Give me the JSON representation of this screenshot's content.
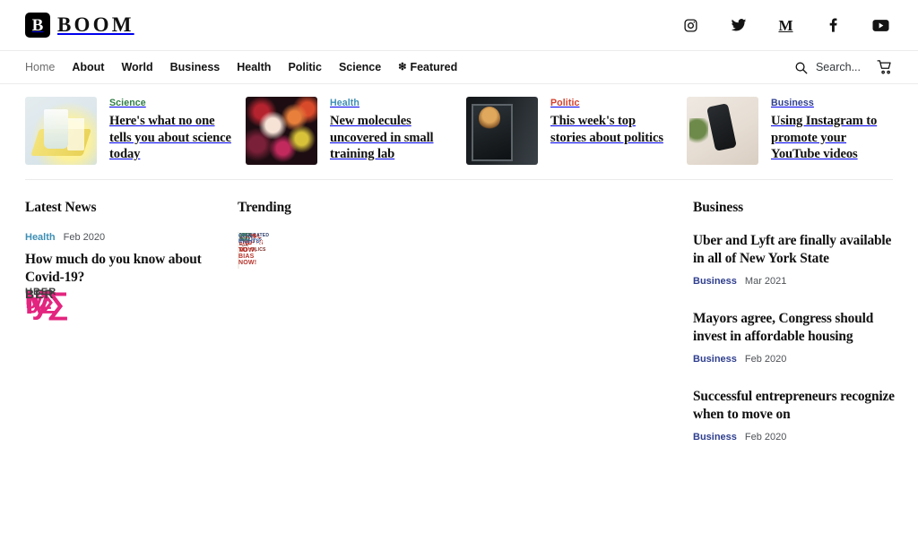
{
  "site": {
    "logo_mark": "B",
    "logo_text": "BOOM"
  },
  "social": [
    {
      "name": "instagram-icon",
      "label": "Instagram"
    },
    {
      "name": "twitter-icon",
      "label": "Twitter"
    },
    {
      "name": "medium-icon",
      "label": "M"
    },
    {
      "name": "facebook-icon",
      "label": "Facebook"
    },
    {
      "name": "youtube-icon",
      "label": "YouTube"
    }
  ],
  "nav": {
    "items": [
      {
        "label": "Home",
        "active": true
      },
      {
        "label": "About",
        "active": false
      },
      {
        "label": "World",
        "active": false
      },
      {
        "label": "Business",
        "active": false
      },
      {
        "label": "Health",
        "active": false
      },
      {
        "label": "Politic",
        "active": false
      },
      {
        "label": "Science",
        "active": false
      }
    ],
    "featured_label": "Featured",
    "featured_icon": "❇",
    "search_placeholder": "Search...",
    "cart_icon": "cart-icon"
  },
  "colors": {
    "science": "#2e7d46",
    "health": "#3d8fb5",
    "politic": "#d6402c",
    "business": "#2f3f8f",
    "text": "#111111",
    "muted": "#4e5257",
    "rule": "#eaeaea"
  },
  "featured": [
    {
      "category": "Science",
      "title": "Here's what no one tells you about science today",
      "thumb": "science-lab-flasks"
    },
    {
      "category": "Health",
      "title": "New molecules uncovered in small training lab",
      "thumb": "colorful-bokeh-molecules"
    },
    {
      "category": "Politic",
      "title": "This week's top stories about politics",
      "thumb": "politician-portrait-frame"
    },
    {
      "category": "Business",
      "title": "Using Instagram to promote your YouTube videos",
      "thumb": "hand-holding-phone-instagram"
    }
  ],
  "latest_news": {
    "heading": "Latest News",
    "articles": [
      {
        "thumb": "covid-19-vaccine-vials",
        "category": "Health",
        "date": "Feb 2020",
        "title": "How much do you know about Covid-19?"
      },
      {
        "thumb": "uber-lyft-toy-cars",
        "category": "",
        "date": "",
        "title": ""
      }
    ]
  },
  "trending": {
    "heading": "Trending",
    "hero_image": "march-on-washington-protest-signs",
    "hero_sign_texts": [
      "WE DEMAND",
      "WE MARCH FOR",
      "JOBS FOR ALL",
      "EQUAL RIGHTS NOW!",
      "AN END TO BIAS NOW!",
      "INTEGRATED SCHOOLS NOW!",
      "CATHOLICS",
      "CIVIL RIGHTS"
    ]
  },
  "business_sidebar": {
    "heading": "Business",
    "articles": [
      {
        "title": "Uber and Lyft are finally available in all of New York State",
        "category": "Business",
        "date": "Mar 2021"
      },
      {
        "title": "Mayors agree, Congress should invest in affordable housing",
        "category": "Business",
        "date": "Feb 2020"
      },
      {
        "title": "Successful entrepreneurs recognize when to move on",
        "category": "Business",
        "date": "Feb 2020"
      }
    ]
  }
}
